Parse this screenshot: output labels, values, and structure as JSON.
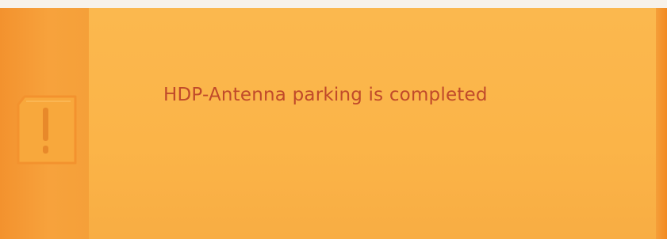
{
  "dialog": {
    "message": "HDP-Antenna parking is completed",
    "icon": "warning-exclamation-icon"
  },
  "colors": {
    "panel": "#fbb84e",
    "left_strip": "#f59f3a",
    "right_strip": "#f28a22",
    "message_text": "#c04a2a",
    "icon_fill": "#f8a83c"
  }
}
